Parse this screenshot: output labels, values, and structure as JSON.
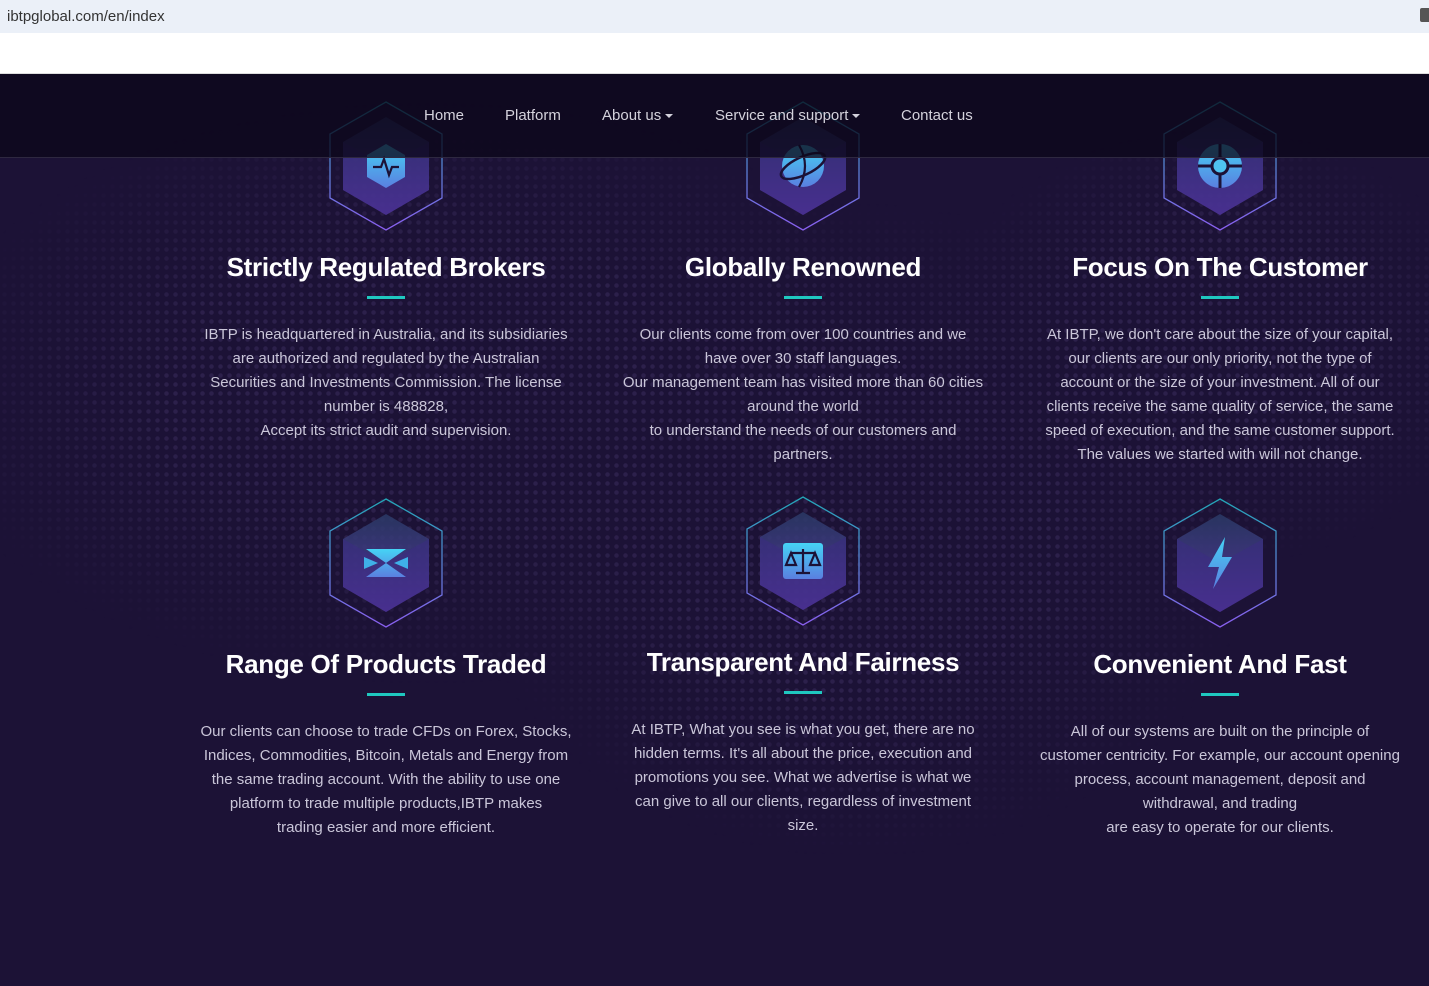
{
  "browser": {
    "url": "ibtpglobal.com/en/index"
  },
  "nav": {
    "items": [
      {
        "label": "Home"
      },
      {
        "label": "Platform"
      },
      {
        "label": "About us"
      },
      {
        "label": "Service and support"
      },
      {
        "label": "Contact us"
      }
    ]
  },
  "colors": {
    "accent": "#1fc8c0",
    "background": "#1c1236"
  },
  "features": [
    {
      "icon": "pulse-icon",
      "title": "Strictly Regulated Brokers",
      "lines": [
        "IBTP is headquartered in Australia, and its subsidiaries",
        "are authorized and regulated by the Australian",
        "Securities and Investments Commission. The license",
        "number is 488828,",
        "Accept its strict audit and supervision."
      ]
    },
    {
      "icon": "globe-icon",
      "title": "Globally Renowned",
      "lines": [
        "Our clients come from over 100 countries and we",
        "have over 30 staff languages.",
        "Our management team has visited more than 60 cities",
        "around the world",
        "to understand the needs of our customers and",
        "partners."
      ]
    },
    {
      "icon": "target-icon",
      "title": "Focus On The Customer",
      "lines": [
        "At IBTP, we don't care about the size of your capital,",
        "our clients are our only priority, not the type of",
        "account or the size of your investment. All of our",
        "clients receive the same quality of service, the same",
        "speed of execution, and the same customer support.",
        "The values we started with will not change."
      ]
    },
    {
      "icon": "exchange-icon",
      "title": "Range Of Products Traded",
      "lines": [
        "Our clients can choose to trade CFDs on Forex, Stocks,",
        "Indices, Commodities, Bitcoin, Metals and Energy from",
        "the same trading account. With the ability to use one",
        "platform to trade multiple products,IBTP makes",
        "trading easier and more efficient."
      ]
    },
    {
      "icon": "scale-icon",
      "title": "Transparent And Fairness",
      "lines": [
        "At IBTP, What you see is what you get, there are no",
        "hidden terms. It's all about the price, execution and",
        "promotions you see. What we advertise is what we",
        "can give to all our clients, regardless of investment",
        "size."
      ]
    },
    {
      "icon": "lightning-icon",
      "title": "Convenient And Fast",
      "lines": [
        "All of our systems are built on the principle of",
        "customer centricity. For example, our account opening",
        "process, account management, deposit and",
        "withdrawal, and trading",
        "are easy to operate for our clients."
      ]
    }
  ]
}
